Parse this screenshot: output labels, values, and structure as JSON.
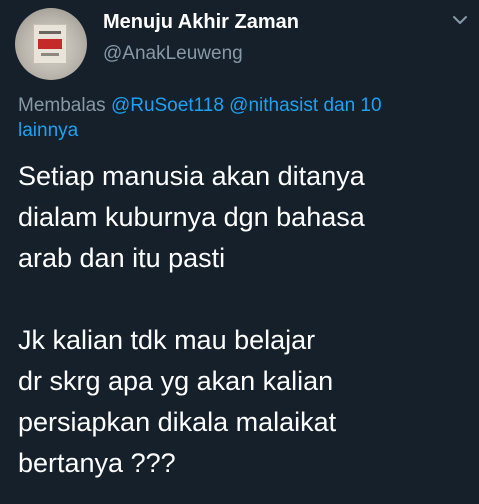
{
  "author": {
    "display_name": "Menuju Akhir Zaman",
    "handle": "@AnakLeuweng",
    "avatar_icon": "profile-photo"
  },
  "menu": {
    "icon": "chevron-down-icon"
  },
  "reply": {
    "prefix": "Membalas",
    "mention_1": "@RuSoet118",
    "mention_2": "@nithasist",
    "suffix_1": "dan 10",
    "suffix_2": "lainnya"
  },
  "body": {
    "lines": [
      "Setiap manusia akan ditanya",
      "dialam kuburnya dgn bahasa",
      "arab dan itu pasti",
      "",
      "Jk kalian tdk mau belajar",
      "dr skrg apa yg akan kalian",
      "persiapkan dikala malaikat",
      "bertanya ???"
    ]
  },
  "colors": {
    "background": "#15202b",
    "primary_text": "#ffffff",
    "secondary_text": "#8899a6",
    "mention": "#1da1f2"
  }
}
